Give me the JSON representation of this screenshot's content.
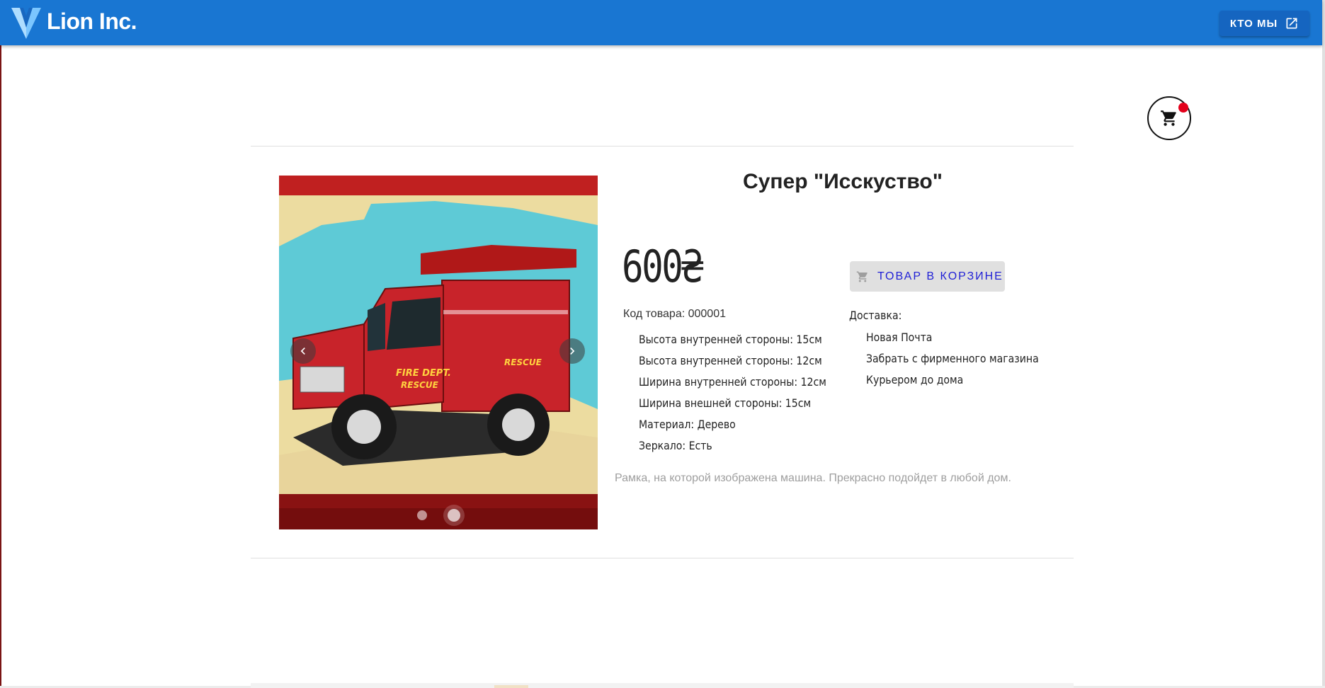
{
  "header": {
    "brand": "Lion Inc.",
    "about_label": "КТО МЫ",
    "about_icon": "open-in-new-icon",
    "logo_icon": "vuetify-logo-icon",
    "bar_color": "#1976d2"
  },
  "cart": {
    "icon": "cart-icon",
    "badge_color": "#e3001b"
  },
  "product": {
    "title": "Супер \"Исскуство\"",
    "price": "600₴",
    "code": "Код товара: 000001",
    "specs": [
      "Высота внутренней стороны: 15см",
      "Высота внутренней стороны: 12см",
      "Ширина внутренней стороны: 12см",
      "Ширина внешней стороны: 15см",
      "Материал: Дерево",
      "Зеркало: Есть"
    ],
    "description": "Рамка, на которой изображена машина. Прекрасно подойдет в любой дом.",
    "cart_button_label": "ТОВАР В КОРЗИНЕ",
    "delivery_title": "Доставка:",
    "delivery_options": [
      "Новая Почта",
      "Забрать с фирменного магазина",
      "Курьером до дома"
    ]
  },
  "carousel": {
    "slides": 2,
    "active_slide": 2,
    "truck_texts": {
      "door": "FIRE DEPT.",
      "door2": "RESCUE",
      "side": "RESCUE"
    }
  }
}
